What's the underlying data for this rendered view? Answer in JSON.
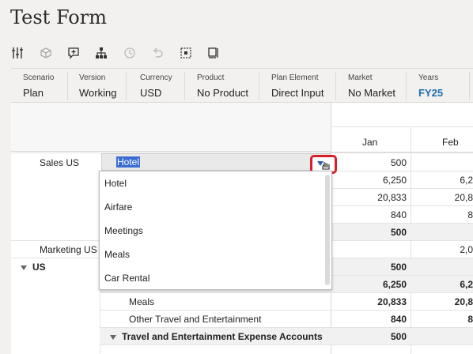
{
  "page_title": "Test Form",
  "toolbar": {
    "icons": [
      "sliders-icon",
      "cube-icon",
      "comment-add-icon",
      "hierarchy-icon",
      "history-icon",
      "undo-icon",
      "grid-select-icon",
      "sheet-options-icon"
    ]
  },
  "pov": [
    {
      "label": "Scenario",
      "value": "Plan"
    },
    {
      "label": "Version",
      "value": "Working"
    },
    {
      "label": "Currency",
      "value": "USD"
    },
    {
      "label": "Product",
      "value": "No Product"
    },
    {
      "label": "Plan Element",
      "value": "Direct Input"
    },
    {
      "label": "Market",
      "value": "No Market"
    },
    {
      "label": "Years",
      "value": "FY25"
    }
  ],
  "grid": {
    "columns": [
      "Jan",
      "Feb"
    ],
    "row_sales": "Sales US",
    "row_marketing": "Marketing US",
    "row_us": "US",
    "jan_values": [
      "500",
      "6,250",
      "20,833",
      "840",
      "500",
      "500",
      "6,250",
      "20,833",
      "840",
      "500"
    ],
    "feb_values": [
      "6,2",
      "20,8",
      "8",
      "2,0",
      "6,2",
      "20,8",
      "8"
    ],
    "rows": [
      {
        "label": "Meals",
        "jan": "20,833",
        "feb": "20,8"
      },
      {
        "label": "Other Travel and Entertainment",
        "jan": "840",
        "feb": "8"
      },
      {
        "label": "Travel and Entertainment Expense Accounts",
        "jan": "500",
        "feb": ""
      }
    ]
  },
  "dropdown": {
    "selected": "Hotel",
    "options": [
      "Hotel",
      "Airfare",
      "Meetings",
      "Meals",
      "Car Rental"
    ]
  }
}
